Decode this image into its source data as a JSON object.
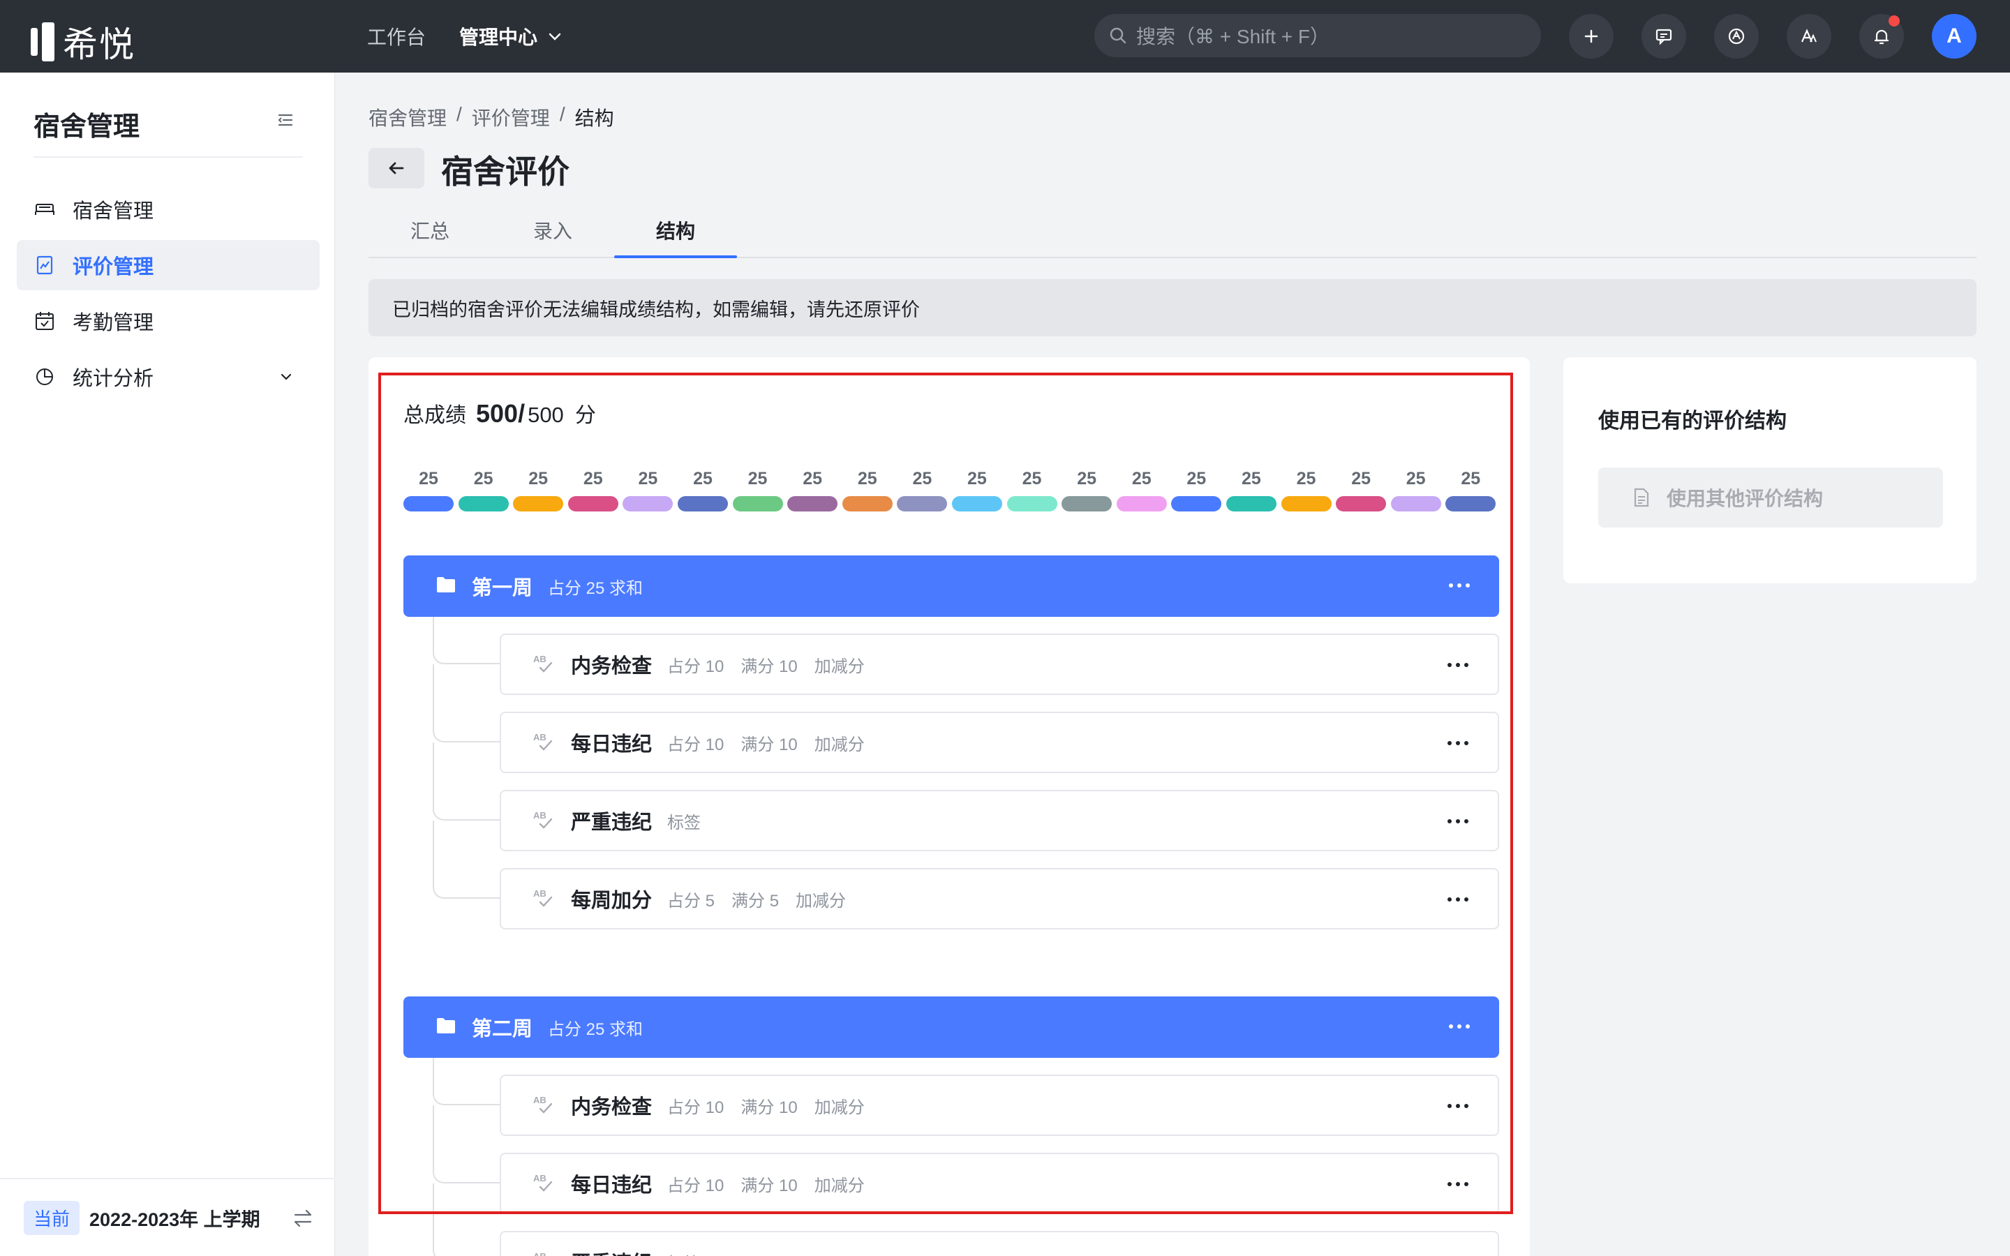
{
  "app": {
    "logo_text": "希悦",
    "nav": [
      {
        "label": "工作台",
        "active": false
      },
      {
        "label": "管理中心",
        "active": true
      }
    ],
    "search_placeholder": "搜索（⌘ + Shift + F）",
    "avatar_letter": "A"
  },
  "sidebar": {
    "title": "宿舍管理",
    "items": [
      {
        "label": "宿舍管理",
        "icon": "bed-icon",
        "active": false
      },
      {
        "label": "评价管理",
        "icon": "evaluation-doc-icon",
        "active": true
      },
      {
        "label": "考勤管理",
        "icon": "calendar-check-icon",
        "active": false
      },
      {
        "label": "统计分析",
        "icon": "pie-chart-icon",
        "active": false,
        "expandable": true
      }
    ],
    "footer": {
      "badge": "当前",
      "term": "2022-2023年 上学期"
    }
  },
  "breadcrumb": [
    "宿舍管理",
    "评价管理",
    "结构"
  ],
  "breadcrumb_sep": "/",
  "page_title": "宿舍评价",
  "tabs": [
    {
      "label": "汇总",
      "active": false
    },
    {
      "label": "录入",
      "active": false
    },
    {
      "label": "结构",
      "active": true
    }
  ],
  "notice": "已归档的宿舍评价无法编辑成绩结构，如需编辑，请先还原评价",
  "structure": {
    "total_label": "总成绩",
    "total_value": "500/",
    "total_max": "500",
    "total_unit": "分",
    "segments": [
      {
        "value": "25",
        "color": "#4a7aff"
      },
      {
        "value": "25",
        "color": "#2bbfb0"
      },
      {
        "value": "25",
        "color": "#f7a90f"
      },
      {
        "value": "25",
        "color": "#d94f86"
      },
      {
        "value": "25",
        "color": "#c7a8f5"
      },
      {
        "value": "25",
        "color": "#5b73c4"
      },
      {
        "value": "25",
        "color": "#6cc983"
      },
      {
        "value": "25",
        "color": "#9a6a9f"
      },
      {
        "value": "25",
        "color": "#e88b46"
      },
      {
        "value": "25",
        "color": "#8e92c0"
      },
      {
        "value": "25",
        "color": "#5ec6f7"
      },
      {
        "value": "25",
        "color": "#7de8cd"
      },
      {
        "value": "25",
        "color": "#87999a"
      },
      {
        "value": "25",
        "color": "#f0a0f0"
      },
      {
        "value": "25",
        "color": "#4a7aff"
      },
      {
        "value": "25",
        "color": "#2bbfb0"
      },
      {
        "value": "25",
        "color": "#f7a90f"
      },
      {
        "value": "25",
        "color": "#d94f86"
      },
      {
        "value": "25",
        "color": "#c7a8f5"
      },
      {
        "value": "25",
        "color": "#5b73c4"
      }
    ],
    "groups": [
      {
        "title": "第一周",
        "meta": "占分 25 求和",
        "items": [
          {
            "title": "内务检查",
            "meta": [
              "占分 10",
              "满分 10",
              "加减分"
            ]
          },
          {
            "title": "每日违纪",
            "meta": [
              "占分 10",
              "满分 10",
              "加减分"
            ]
          },
          {
            "title": "严重违纪",
            "meta": [
              "标签"
            ]
          },
          {
            "title": "每周加分",
            "meta": [
              "占分 5",
              "满分 5",
              "加减分"
            ]
          }
        ]
      },
      {
        "title": "第二周",
        "meta": "占分 25 求和",
        "items": [
          {
            "title": "内务检查",
            "meta": [
              "占分 10",
              "满分 10",
              "加减分"
            ]
          },
          {
            "title": "每日违纪",
            "meta": [
              "占分 10",
              "满分 10",
              "加减分"
            ]
          },
          {
            "title": "严重违纪",
            "meta": [
              "标签"
            ]
          }
        ]
      }
    ]
  },
  "side_panel": {
    "title": "使用已有的评价结构",
    "button": "使用其他评价结构"
  }
}
